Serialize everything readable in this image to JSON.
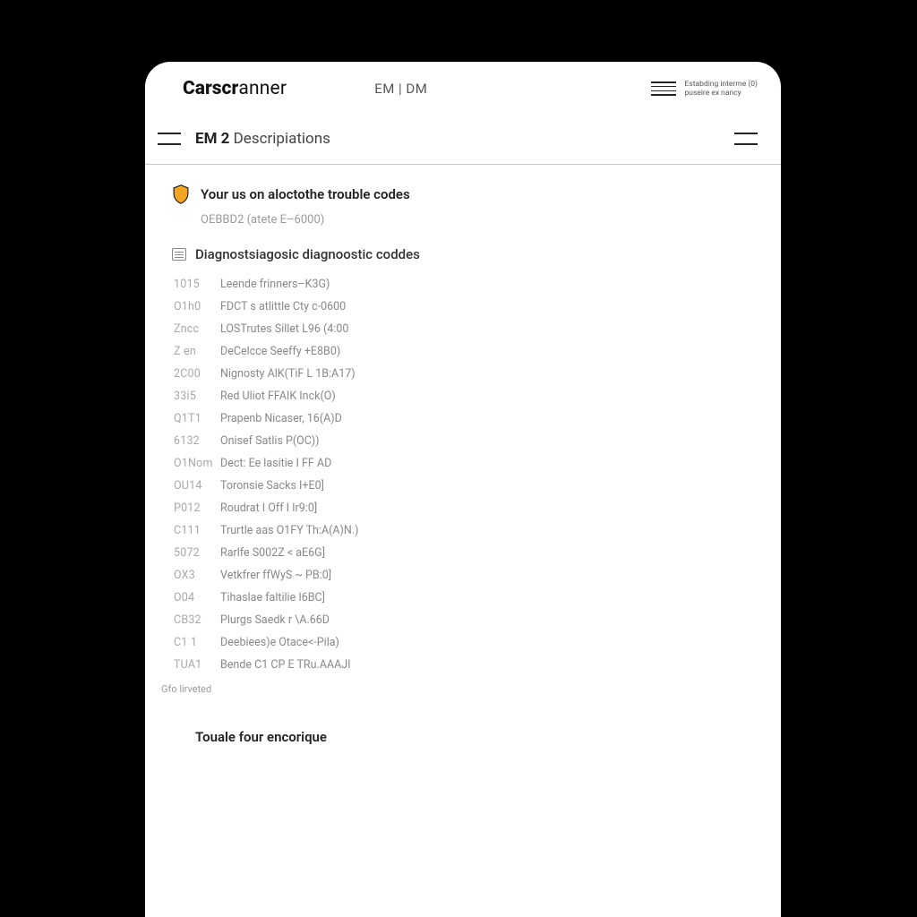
{
  "header": {
    "brand_bold": "Carscr",
    "brand_rest": "anner",
    "mid_label": "EM | DM",
    "right_line1": "Estabding interme (0)",
    "right_line2": "puseire ex nancy"
  },
  "subheader": {
    "title_bold": "EM 2",
    "title_rest": " Descripiations"
  },
  "banner": {
    "title": "Your us on aloctothe trouble codes",
    "subtitle": "OEBBD2  (atete E–6000)"
  },
  "section": {
    "title": "Diagnostsiagosic diagnoostic coddes"
  },
  "codes": [
    {
      "code": "1015",
      "desc": "Leende frinners–K3G)"
    },
    {
      "code": "O1h0",
      "desc": "FDCT s  atlittle Cty c-0600"
    },
    {
      "code": "Zncc",
      "desc": "LOSTrutes Sillet L96 (4:00"
    },
    {
      "code": "Z en",
      "desc": "DeCelcce Seeffy +E8B0)"
    },
    {
      "code": "2C00",
      "desc": "Nignosty AlK(TiF L  1B:A17)"
    },
    {
      "code": "33i5",
      "desc": "Red Uliot FFAIK  Inck(O)"
    },
    {
      "code": "Q1T1",
      "desc": "Prapenb Nicaser, 16(A)D"
    },
    {
      "code": "6132",
      "desc": "Onisef Satlis P(OC))"
    },
    {
      "code": "O1Nom",
      "desc": "Dect: Ee lasitie I FF AD"
    },
    {
      "code": "OU14",
      "desc": "Toronsie Sacks  I+E0]"
    },
    {
      "code": "P012",
      "desc": "Roudrat I Off I   Ir9:0]"
    },
    {
      "code": "C111",
      "desc": "Trurtle aas  O1FY Th:A(A)N.)"
    },
    {
      "code": "5072",
      "desc": "Rarlfe S002Z <  aE6G]"
    },
    {
      "code": "OX3",
      "desc": "Vetkfrer ffWyS ~ PB:0]"
    },
    {
      "code": "O04",
      "desc": "Tihaslae faltilie I6BC]"
    },
    {
      "code": "CB32",
      "desc": "Plurgs Saedk r  \\A.66D"
    },
    {
      "code": "C1 1",
      "desc": "Deebiees)e  Otace<-Pila)"
    },
    {
      "code": "TUA1",
      "desc": "Bende C1  CP   E TRu.AAAJI"
    }
  ],
  "footer_note": "Gfo lirveted",
  "bottom_section": "Touale four encorique"
}
